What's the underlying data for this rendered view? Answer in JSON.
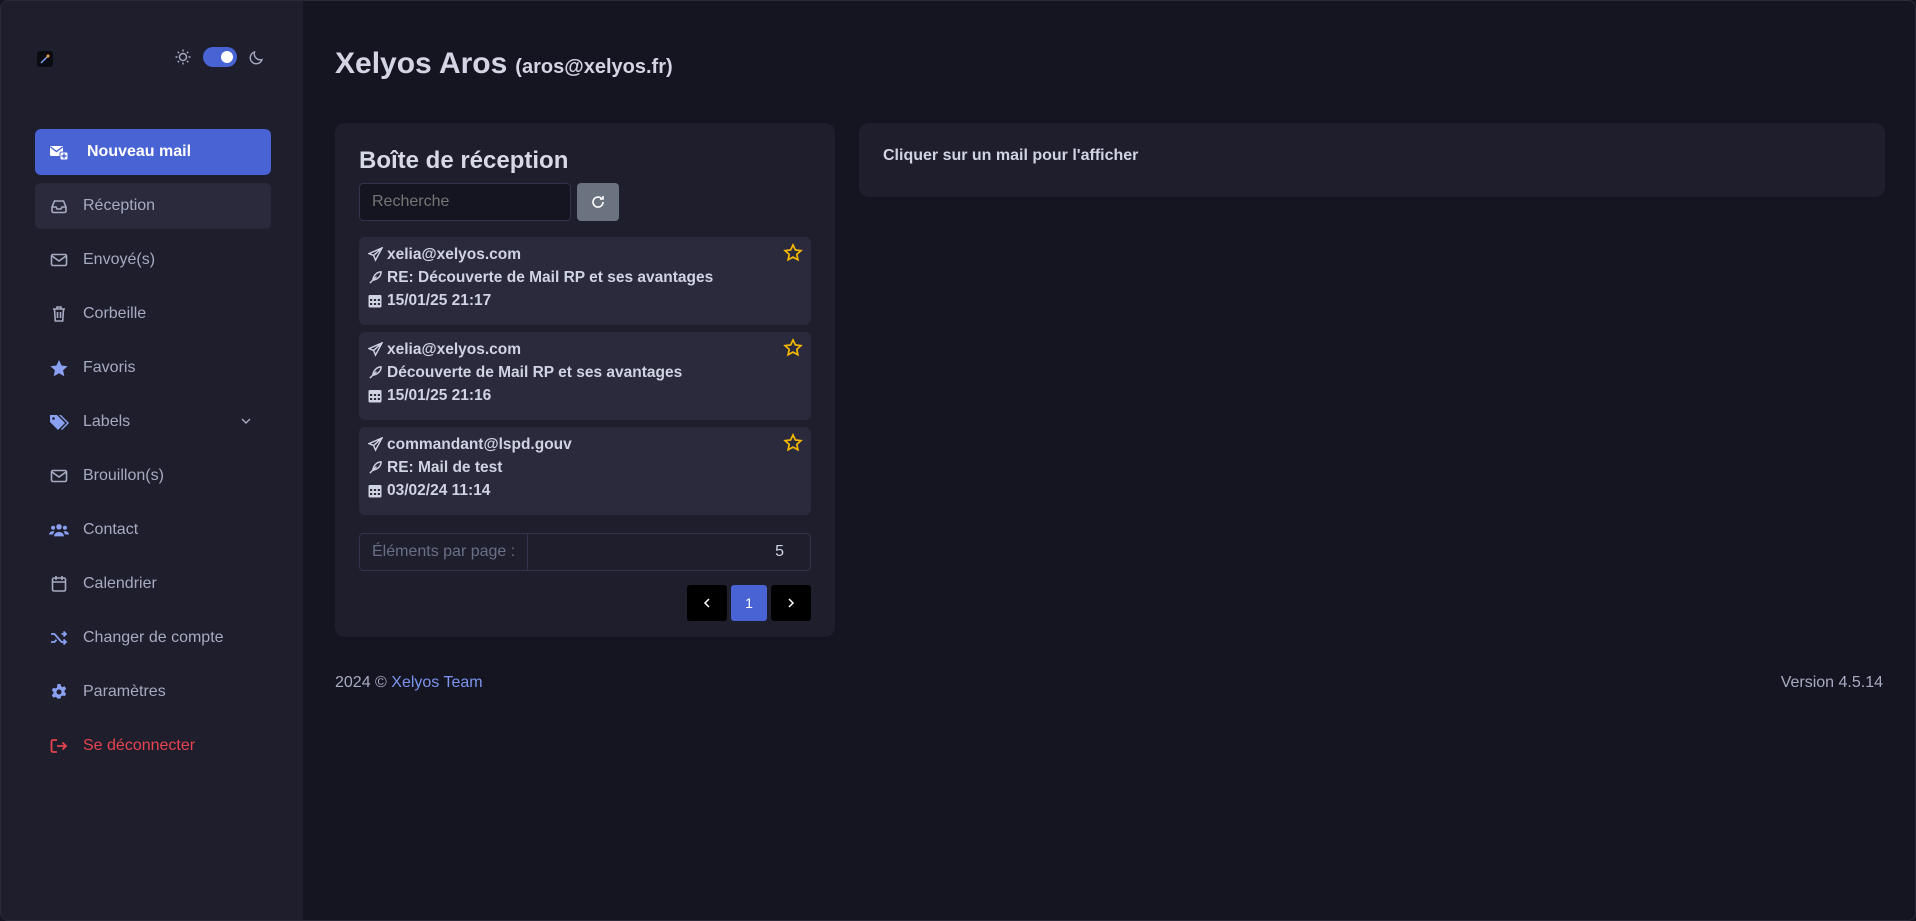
{
  "user": {
    "name": "Xelyos Aros",
    "email": "(aros@xelyos.fr)"
  },
  "sidebar": {
    "items": [
      {
        "label": "Nouveau mail"
      },
      {
        "label": "Réception"
      },
      {
        "label": "Envoyé(s)"
      },
      {
        "label": "Corbeille"
      },
      {
        "label": "Favoris"
      },
      {
        "label": "Labels"
      },
      {
        "label": "Brouillon(s)"
      },
      {
        "label": "Contact"
      },
      {
        "label": "Calendrier"
      },
      {
        "label": "Changer de compte"
      },
      {
        "label": "Paramètres"
      },
      {
        "label": "Se déconnecter"
      }
    ]
  },
  "inbox": {
    "title": "Boîte de réception",
    "search_placeholder": "Recherche",
    "mails": [
      {
        "from": "xelia@xelyos.com",
        "subject": "RE: Découverte de Mail RP et ses avantages",
        "date": "15/01/25 21:17"
      },
      {
        "from": "xelia@xelyos.com",
        "subject": "Découverte de Mail RP et ses avantages",
        "date": "15/01/25 21:16"
      },
      {
        "from": "commandant@lspd.gouv",
        "subject": "RE: Mail de test",
        "date": "03/02/24 11:14"
      }
    ],
    "per_page_label": "Éléments par page :",
    "per_page_value": "5",
    "current_page": "1"
  },
  "viewer": {
    "hint": "Cliquer sur un mail pour l'afficher"
  },
  "footer": {
    "copyright": "2024 © ",
    "team": "Xelyos Team",
    "version": "Version 4.5.14"
  },
  "colors": {
    "accent": "#4863d3",
    "danger": "#e8434f",
    "star": "#f5b800"
  }
}
